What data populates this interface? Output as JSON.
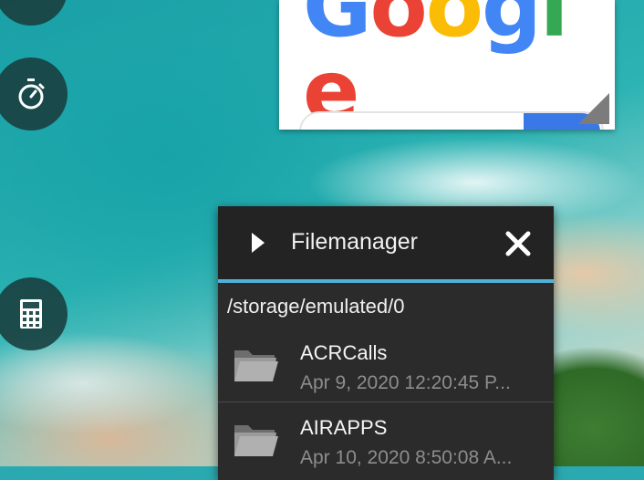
{
  "google_widget": {
    "logo_letters": [
      {
        "ch": "G",
        "color": "#4285F4"
      },
      {
        "ch": "o",
        "color": "#EA4335"
      },
      {
        "ch": "o",
        "color": "#FBBC05"
      },
      {
        "ch": "g",
        "color": "#4285F4"
      },
      {
        "ch": "l",
        "color": "#34A853"
      },
      {
        "ch": "e",
        "color": "#EA4335"
      }
    ]
  },
  "side_buttons": [
    {
      "icon": "timer-icon"
    },
    {
      "icon": "calculator-icon"
    }
  ],
  "filemanager": {
    "title": "Filemanager",
    "path": "/storage/emulated/0",
    "header_accent": "#4fb3d9",
    "items": [
      {
        "name": "ACRCalls",
        "date": "Apr 9, 2020 12:20:45 P...",
        "icon": "folder-icon"
      },
      {
        "name": "AIRAPPS",
        "date": "Apr 10, 2020 8:50:08 A...",
        "icon": "folder-icon"
      }
    ]
  }
}
